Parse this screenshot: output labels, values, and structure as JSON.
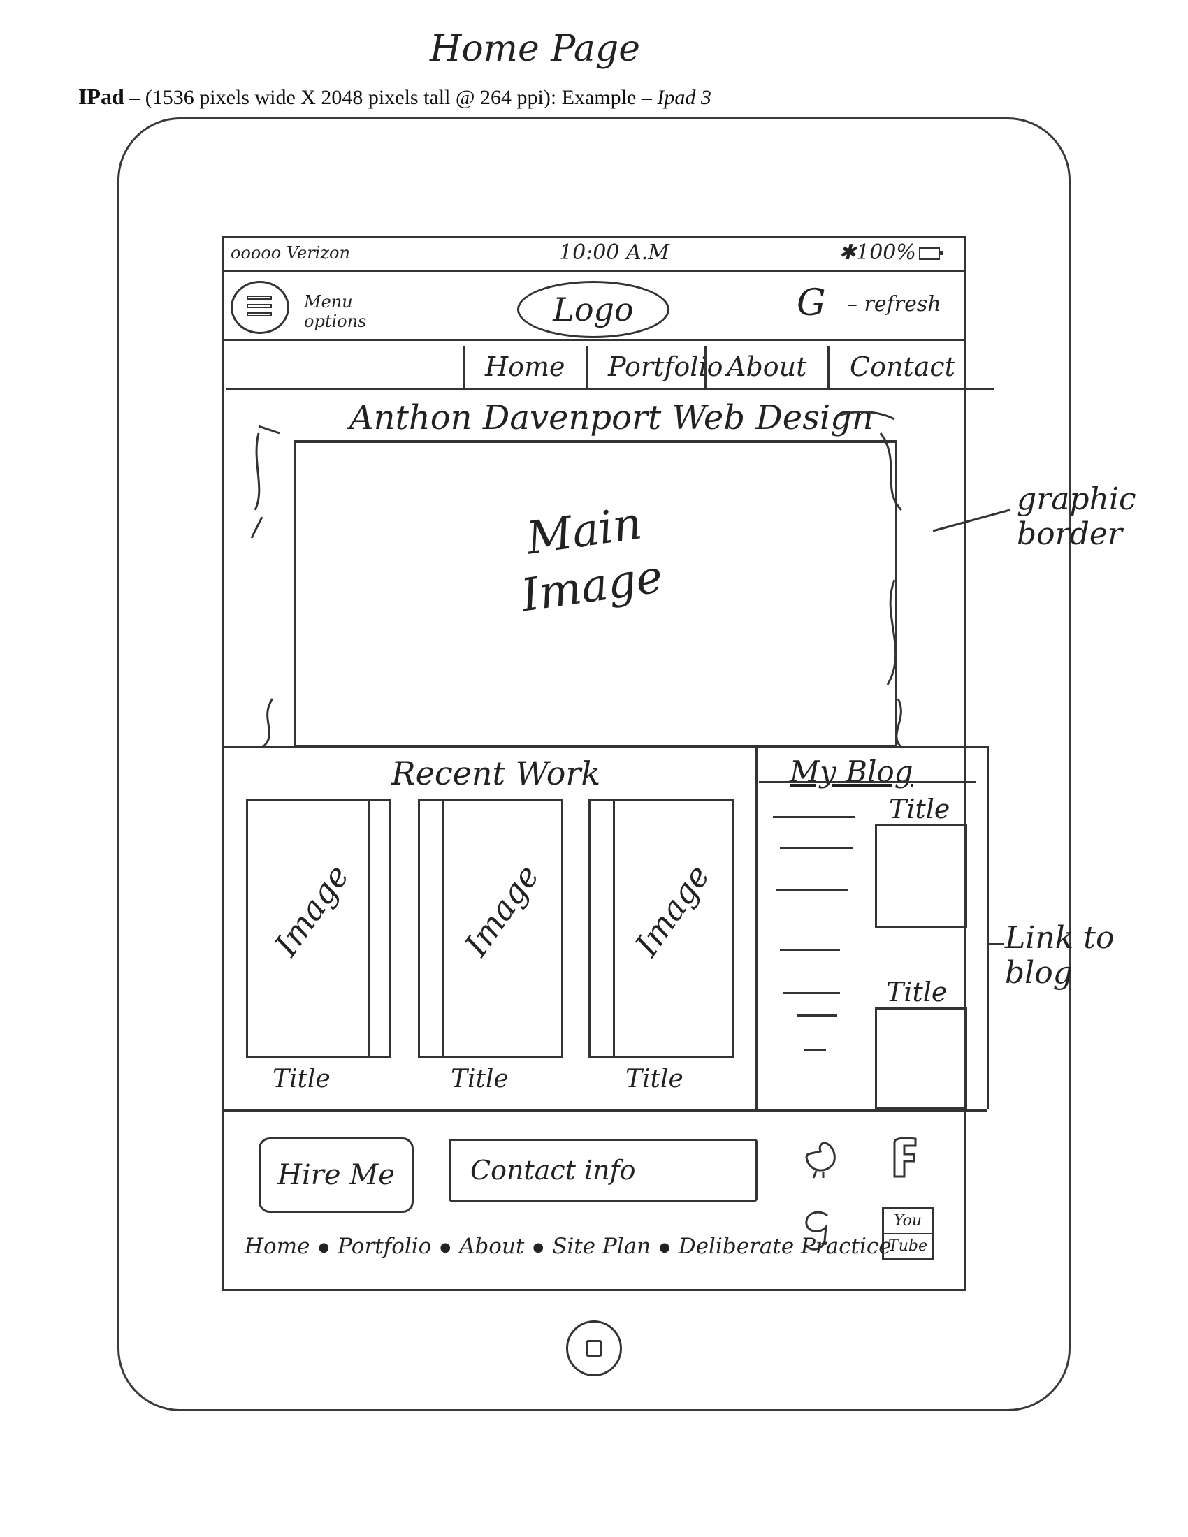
{
  "page_title": "Home Page",
  "device_heading": {
    "name": "IPad",
    "spec": " – (1536 pixels wide X 2048 pixels tall @ 264 ppi): Example – ",
    "example": "Ipad 3"
  },
  "status_bar": {
    "carrier": "ooooo Verizon",
    "time": "10:00 A.M",
    "battery": "✱100%"
  },
  "header": {
    "menu_label": "Menu options",
    "logo": "Logo",
    "refresh_icon": "G",
    "refresh_label": "– refresh"
  },
  "nav": [
    "Home",
    "Portfolio",
    "About",
    "Contact"
  ],
  "hero": {
    "title": "Anthon Davenport Web Design",
    "image_label_1": "Main",
    "image_label_2": "Image"
  },
  "annotations": {
    "graphic_border": [
      "graphic",
      "border"
    ],
    "link_to_blog": [
      "Link to",
      "blog"
    ]
  },
  "recent_work": {
    "title": "Recent Work",
    "cards": [
      {
        "image_label": "Image",
        "title": "Title"
      },
      {
        "image_label": "Image",
        "title": "Title"
      },
      {
        "image_label": "Image",
        "title": "Title"
      }
    ]
  },
  "blog": {
    "title": "My Blog",
    "posts": [
      {
        "title": "Title"
      },
      {
        "title": "Title"
      }
    ]
  },
  "footer": {
    "hire_button": "Hire Me",
    "contact_info": "Contact info",
    "social_icons": [
      "bird-icon",
      "facebook-icon",
      "google-icon",
      "youtube-icon"
    ],
    "youtube_text": [
      "You",
      "Tube"
    ],
    "links": [
      "Home",
      "Portfolio",
      "About",
      "Site Plan",
      "Deliberate Practice"
    ]
  }
}
